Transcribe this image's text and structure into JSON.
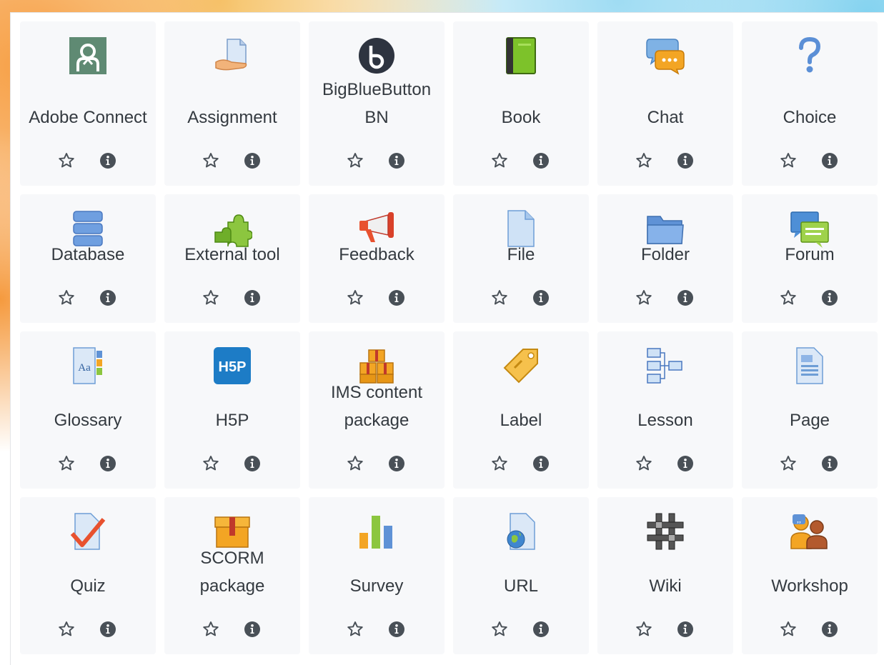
{
  "activities": [
    {
      "icon": "adobe-connect-icon",
      "label": "Adobe Connect"
    },
    {
      "icon": "assignment-icon",
      "label": "Assignment"
    },
    {
      "icon": "bigbluebutton-icon",
      "label": "BigBlueButton BN"
    },
    {
      "icon": "book-icon",
      "label": "Book"
    },
    {
      "icon": "chat-icon",
      "label": "Chat"
    },
    {
      "icon": "choice-icon",
      "label": "Choice"
    },
    {
      "icon": "database-icon",
      "label": "Database"
    },
    {
      "icon": "external-tool-icon",
      "label": "External tool"
    },
    {
      "icon": "feedback-icon",
      "label": "Feedback"
    },
    {
      "icon": "file-icon",
      "label": "File"
    },
    {
      "icon": "folder-icon",
      "label": "Folder"
    },
    {
      "icon": "forum-icon",
      "label": "Forum"
    },
    {
      "icon": "glossary-icon",
      "label": "Glossary"
    },
    {
      "icon": "h5p-icon",
      "label": "H5P",
      "icon_text": "H5P"
    },
    {
      "icon": "ims-content-package-icon",
      "label": "IMS content package"
    },
    {
      "icon": "label-icon",
      "label": "Label"
    },
    {
      "icon": "lesson-icon",
      "label": "Lesson"
    },
    {
      "icon": "page-icon",
      "label": "Page"
    },
    {
      "icon": "quiz-icon",
      "label": "Quiz"
    },
    {
      "icon": "scorm-package-icon",
      "label": "SCORM package"
    },
    {
      "icon": "survey-icon",
      "label": "Survey"
    },
    {
      "icon": "url-icon",
      "label": "URL"
    },
    {
      "icon": "wiki-icon",
      "label": "Wiki"
    },
    {
      "icon": "workshop-icon",
      "label": "Workshop"
    }
  ],
  "action_icons": {
    "star": "star-outline-icon",
    "info": "info-circle-icon"
  },
  "colors": {
    "card_bg": "#f7f8fa",
    "text": "#343a40",
    "action_icon": "#495057"
  }
}
